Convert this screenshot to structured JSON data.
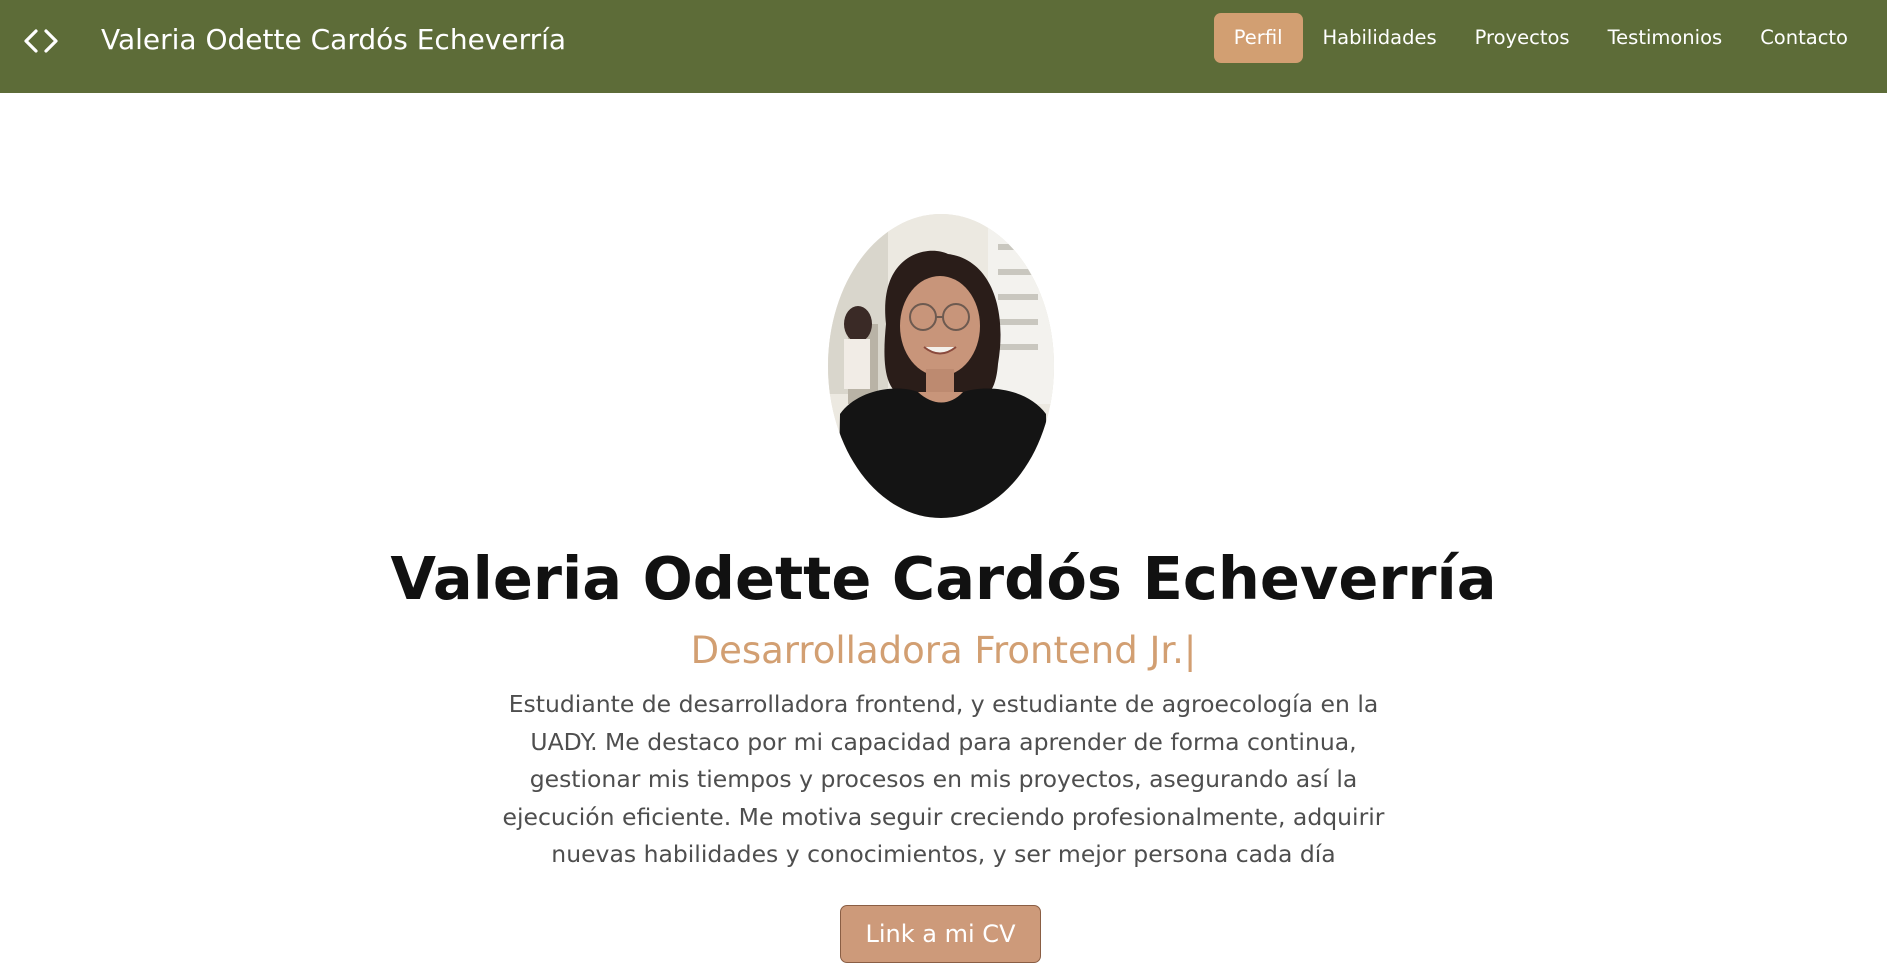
{
  "header": {
    "brand_title": "Valeria Odette Cardós Echeverría",
    "nav": [
      {
        "label": "Perfil",
        "active": true
      },
      {
        "label": "Habilidades",
        "active": false
      },
      {
        "label": "Proyectos",
        "active": false
      },
      {
        "label": "Testimonios",
        "active": false
      },
      {
        "label": "Contacto",
        "active": false
      }
    ]
  },
  "hero": {
    "name": "Valeria Odette Cardós Echeverría",
    "role": "Desarrolladora Frontend Jr.|",
    "bio": "Estudiante de desarrolladora frontend, y estudiante de agroecología en la UADY. Me destaco por mi capacidad para aprender de forma continua, gestionar mis tiempos y procesos en mis proyectos, asegurando así la ejecución eficiente. Me motiva seguir creciendo profesionalmente, adquirir nuevas habilidades y conocimientos, y ser mejor persona cada día",
    "cv_button_label": "Link a mi CV"
  },
  "icons": {
    "brand": "code-brackets-icon"
  },
  "colors": {
    "navbar_bg": "#5d6c38",
    "accent": "#d29f72",
    "button_bg": "#cd9a7a",
    "text_dark": "#111111",
    "text_body": "#4e4e4e"
  }
}
